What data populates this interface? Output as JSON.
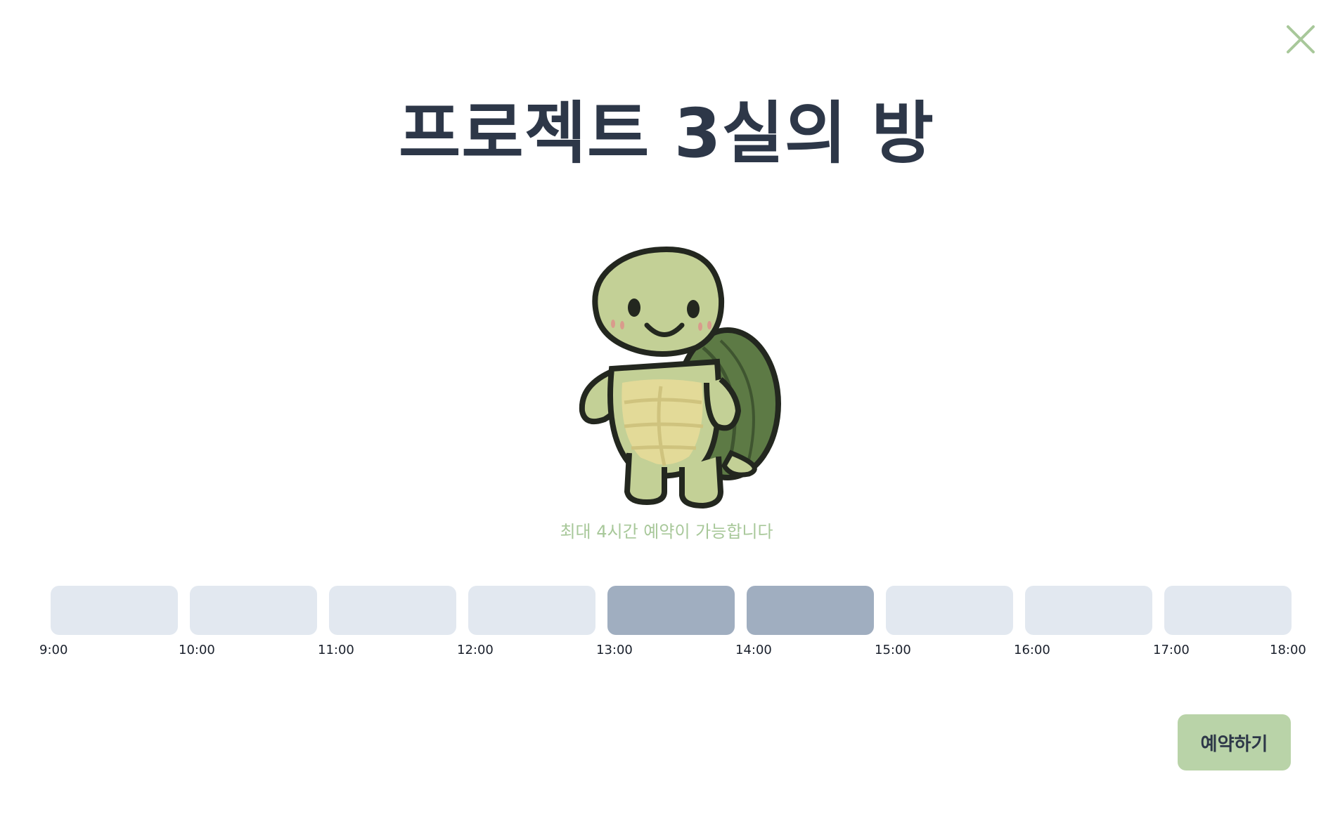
{
  "modal": {
    "title": "프로젝트 3실의 방",
    "hint": "최대 4시간 예약이 가능합니다",
    "close_icon": "close-icon",
    "accent_color": "#a8c89a",
    "mascot_icon": "turtle-mascot-icon"
  },
  "timeline": {
    "ticks": [
      "9:00",
      "10:00",
      "11:00",
      "12:00",
      "13:00",
      "14:00",
      "15:00",
      "16:00",
      "17:00",
      "18:00"
    ],
    "slots": [
      {
        "start": "9:00",
        "selected": false
      },
      {
        "start": "10:00",
        "selected": false
      },
      {
        "start": "11:00",
        "selected": false
      },
      {
        "start": "12:00",
        "selected": false
      },
      {
        "start": "13:00",
        "selected": true
      },
      {
        "start": "14:00",
        "selected": true
      },
      {
        "start": "15:00",
        "selected": false
      },
      {
        "start": "16:00",
        "selected": false
      },
      {
        "start": "17:00",
        "selected": false
      }
    ],
    "slot_color": "#e2e8f0",
    "selected_color": "#a0aec0"
  },
  "actions": {
    "reserve_label": "예약하기",
    "reserve_color": "#b9d3a8"
  }
}
